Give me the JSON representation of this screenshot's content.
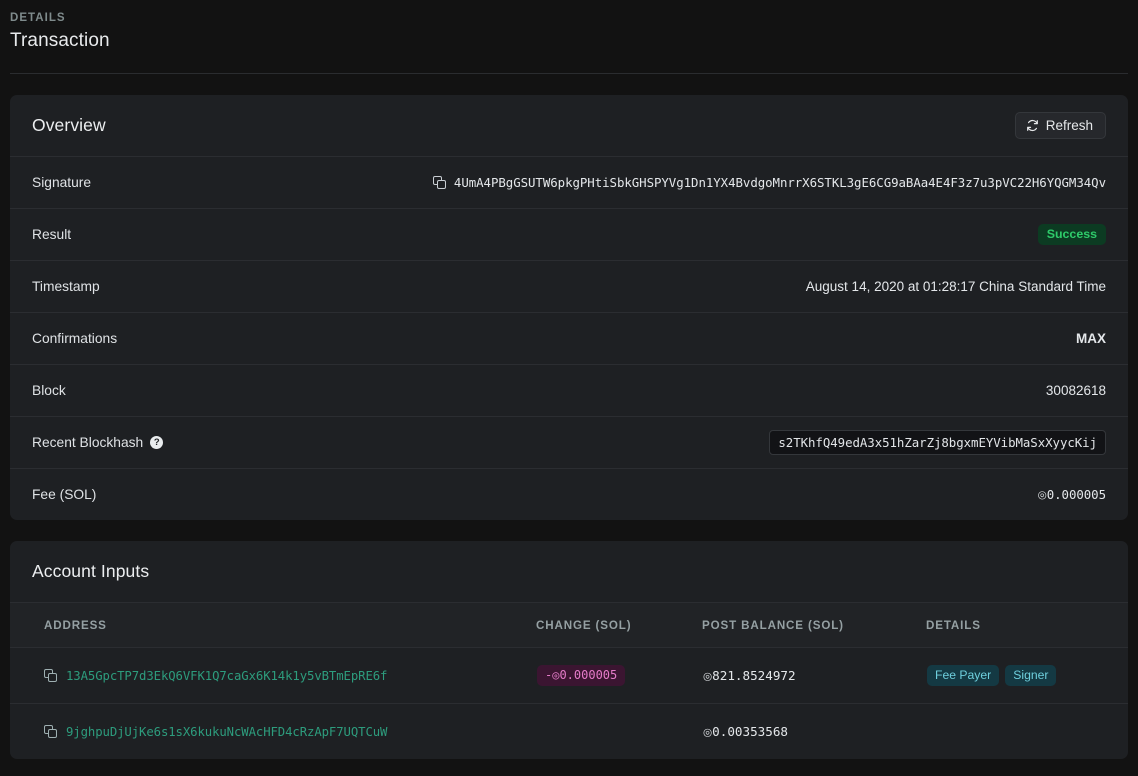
{
  "header": {
    "eyebrow": "DETAILS",
    "title": "Transaction"
  },
  "overview": {
    "title": "Overview",
    "refresh_label": "Refresh",
    "refresh_icon": "refresh-icon",
    "rows": [
      {
        "label": "Signature",
        "value": "4UmA4PBgGSUTW6pkgPHtiSbkGHSPYVg1Dn1YX4BvdgoMnrrX6STKL3gE6CG9aBAa4E4F3z7u3pVC22H6YQGM34Qv"
      },
      {
        "label": "Result",
        "value": "Success"
      },
      {
        "label": "Timestamp",
        "value": "August 14, 2020 at 01:28:17 China Standard Time"
      },
      {
        "label": "Confirmations",
        "value": "MAX"
      },
      {
        "label": "Block",
        "value": "30082618"
      },
      {
        "label": "Recent Blockhash",
        "value": "s2TKhfQ49edA3x51hZarZj8bgxmEYVibMaSxXyycKij",
        "info_icon": "?"
      },
      {
        "label": "Fee (SOL)",
        "sol_symbol": "◎",
        "value": "0.000005"
      }
    ]
  },
  "account_inputs": {
    "title": "Account Inputs",
    "columns": [
      "ADDRESS",
      "CHANGE (SOL)",
      "POST BALANCE (SOL)",
      "DETAILS"
    ],
    "rows": [
      {
        "address": "13A5GpcTP7d3EkQ6VFK1Q7caGx6K14k1y5vBTmEpRE6f",
        "change": "-◎0.000005",
        "post_balance_symbol": "◎",
        "post_balance": "821.8524972",
        "details": [
          "Fee Payer",
          "Signer"
        ]
      },
      {
        "address": "9jghpuDjUjKe6s1sX6kukuNcWAcHFD4cRzApF7UQTCuW",
        "change": "",
        "post_balance_symbol": "◎",
        "post_balance": "0.00353568",
        "details": []
      }
    ]
  },
  "colors": {
    "page_background": "#121212",
    "card_background": "#1e2023",
    "success_text": "#2ecb6a",
    "success_background": "#0c3b22",
    "address_link": "#2d9c7d",
    "change_text": "#e57bc9",
    "change_background": "#3b1531",
    "detail_badge_text": "#6ecfdd",
    "detail_badge_background": "#143943"
  }
}
